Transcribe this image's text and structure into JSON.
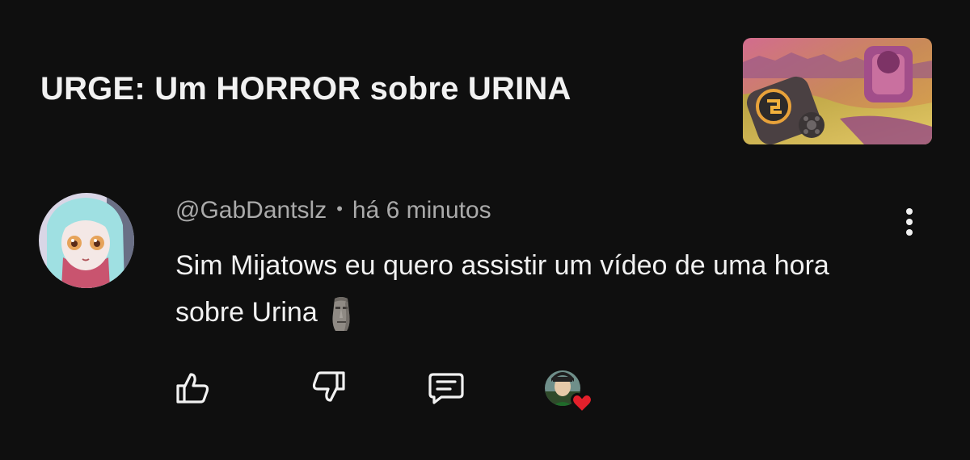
{
  "video": {
    "title": "URGE: Um HORROR sobre URINA",
    "thumbnail_icon": "video-thumbnail"
  },
  "comment": {
    "author": "@GabDantslz",
    "separator": "•",
    "time": "há 6 minutos",
    "text": "Sim Mijatows eu quero assistir um vídeo de uma hora sobre Urina",
    "emoji": "moai-emoji",
    "avatar_icon": "anime-avatar"
  },
  "actions": {
    "like_icon": "thumbs-up-icon",
    "dislike_icon": "thumbs-down-icon",
    "reply_icon": "reply-icon",
    "more_icon": "more-vertical-icon",
    "creator_heart_icon": "creator-heart-icon"
  },
  "colors": {
    "background": "#0f0f0f",
    "text_primary": "#f1f1f1",
    "text_secondary": "#aaaaaa",
    "heart": "#e3202b"
  }
}
